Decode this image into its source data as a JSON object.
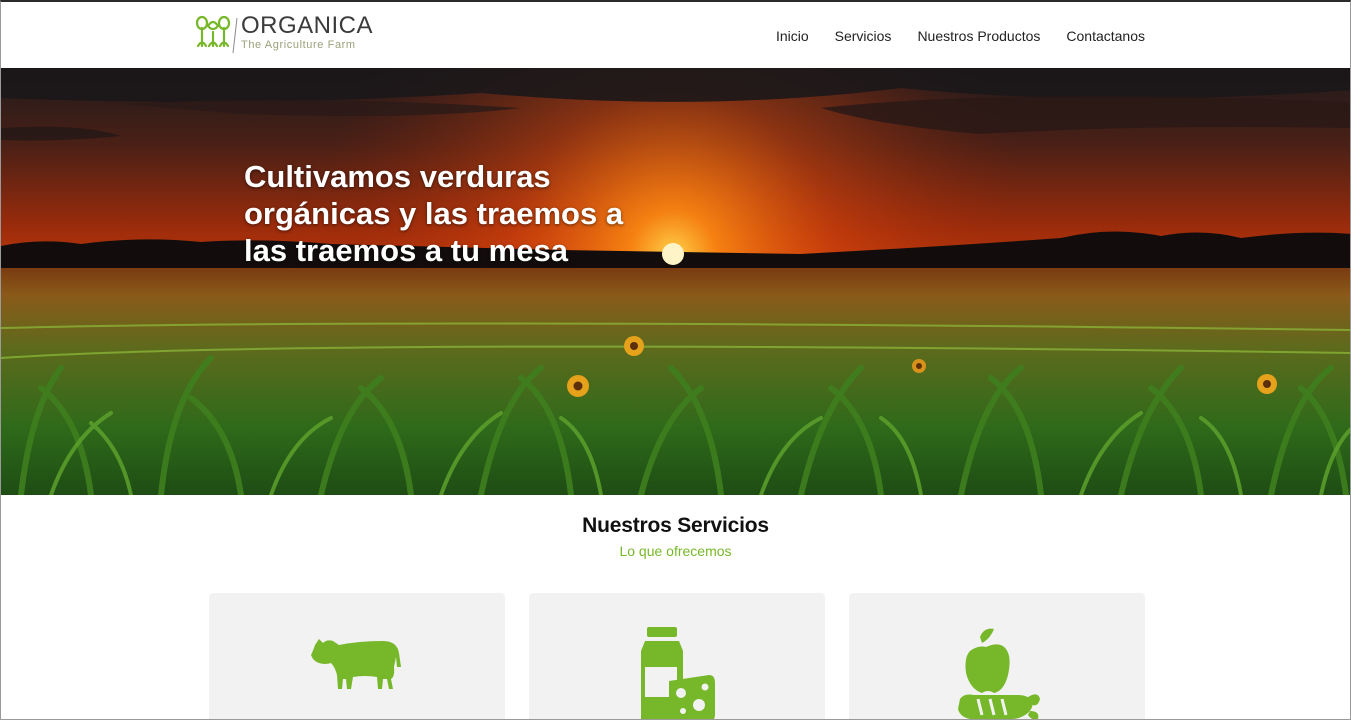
{
  "brand": {
    "name": "ORGANICA",
    "tagline": "The Agriculture Farm",
    "color": "#77b82a"
  },
  "nav": {
    "items": [
      {
        "label": "Inicio"
      },
      {
        "label": "Servicios"
      },
      {
        "label": "Nuestros Productos"
      },
      {
        "label": "Contactanos"
      }
    ]
  },
  "hero": {
    "title": "Cultivamos verduras orgánicas y las traemos a las traemos a tu mesa"
  },
  "services": {
    "title": "Nuestros Servicios",
    "subtitle": "Lo que ofrecemos",
    "cards": [
      {
        "icon": "cow-icon"
      },
      {
        "icon": "dairy-products-icon"
      },
      {
        "icon": "vegetables-icon"
      }
    ]
  }
}
